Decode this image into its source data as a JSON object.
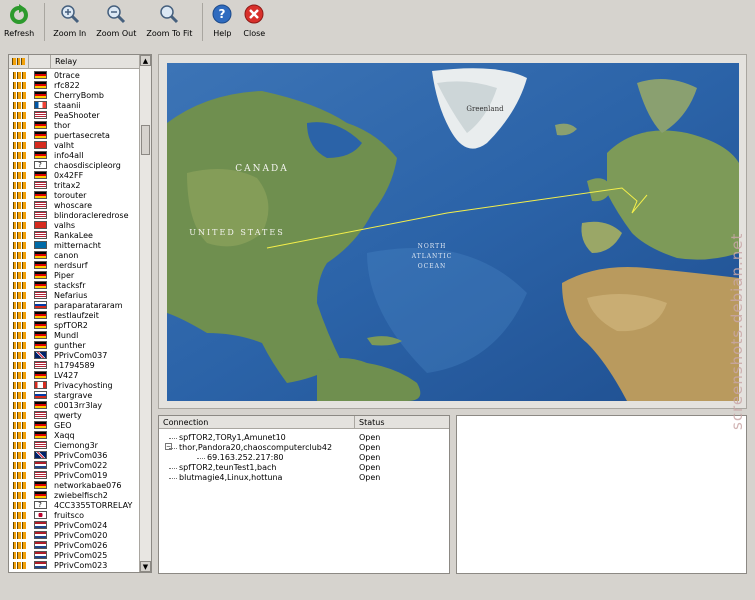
{
  "toolbar": {
    "refresh": "Refresh",
    "zoom_in": "Zoom In",
    "zoom_out": "Zoom Out",
    "zoom_fit": "Zoom To Fit",
    "help": "Help",
    "close": "Close"
  },
  "relay_list": {
    "header": "Relay",
    "items": [
      {
        "name": "0trace",
        "flag": "de"
      },
      {
        "name": "rfc822",
        "flag": "de"
      },
      {
        "name": "CherryBomb",
        "flag": "de"
      },
      {
        "name": "staanii",
        "flag": "fr"
      },
      {
        "name": "PeaShooter",
        "flag": "us"
      },
      {
        "name": "thor",
        "flag": "de"
      },
      {
        "name": "puertasecreta",
        "flag": "de"
      },
      {
        "name": "valht",
        "flag": "ch"
      },
      {
        "name": "info4all",
        "flag": "de"
      },
      {
        "name": "chaosdisciple​org",
        "flag": "unknown"
      },
      {
        "name": "0x42FF",
        "flag": "de"
      },
      {
        "name": "tritax2",
        "flag": "us"
      },
      {
        "name": "torouter",
        "flag": "de"
      },
      {
        "name": "whoscare",
        "flag": "us"
      },
      {
        "name": "blindoracleredrose",
        "flag": "us"
      },
      {
        "name": "valhs",
        "flag": "ch"
      },
      {
        "name": "RankaLee",
        "flag": "us"
      },
      {
        "name": "mitternacht",
        "flag": "se"
      },
      {
        "name": "canon",
        "flag": "de"
      },
      {
        "name": "nerdsurf",
        "flag": "de"
      },
      {
        "name": "Piper",
        "flag": "de"
      },
      {
        "name": "stacksfr",
        "flag": "de"
      },
      {
        "name": "Nefarius",
        "flag": "us"
      },
      {
        "name": "paraparatararam",
        "flag": "ru"
      },
      {
        "name": "restlaufzeit",
        "flag": "de"
      },
      {
        "name": "spfTOR2",
        "flag": "de"
      },
      {
        "name": "Mundl",
        "flag": "de"
      },
      {
        "name": "gunther",
        "flag": "de"
      },
      {
        "name": "PPrivCom037",
        "flag": "gb"
      },
      {
        "name": "h1794589",
        "flag": "us"
      },
      {
        "name": "LV427",
        "flag": "de"
      },
      {
        "name": "Privacyhosting",
        "flag": "ca"
      },
      {
        "name": "stargrave",
        "flag": "ru"
      },
      {
        "name": "c0013rr3lay",
        "flag": "de"
      },
      {
        "name": "qwerty",
        "flag": "us"
      },
      {
        "name": "GEO",
        "flag": "de"
      },
      {
        "name": "Xaqq",
        "flag": "de"
      },
      {
        "name": "Ciemong3r",
        "flag": "us"
      },
      {
        "name": "PPrivCom036",
        "flag": "gb"
      },
      {
        "name": "PPrivCom022",
        "flag": "nl"
      },
      {
        "name": "PPrivCom019",
        "flag": "us"
      },
      {
        "name": "networkabae076",
        "flag": "de"
      },
      {
        "name": "zwiebelfisch2",
        "flag": "de"
      },
      {
        "name": "4CC3355TORRELAY",
        "flag": "unknown"
      },
      {
        "name": "fruitsco",
        "flag": "jp"
      },
      {
        "name": "PPrivCom024",
        "flag": "nl"
      },
      {
        "name": "PPrivCom020",
        "flag": "nl"
      },
      {
        "name": "PPrivCom026",
        "flag": "nl"
      },
      {
        "name": "PPrivCom025",
        "flag": "nl"
      },
      {
        "name": "PPrivCom023",
        "flag": "nl"
      }
    ]
  },
  "map": {
    "labels": {
      "greenland": "Greenland",
      "canada": "CANADA",
      "united_states": "UNITED STATES",
      "ocean_1": "NORTH",
      "ocean_2": "ATLANTIC",
      "ocean_3": "OCEAN"
    }
  },
  "connections": {
    "header_connection": "Connection",
    "header_status": "Status",
    "rows": [
      {
        "name": "spfTOR2,TORy1,Amunet10",
        "status": "Open",
        "indent": 0
      },
      {
        "name": "thor,Pandora20,chaoscomputerclub42",
        "status": "Open",
        "indent": 0,
        "expanded": true
      },
      {
        "name": "69.163.252.217:80",
        "status": "Open",
        "indent": 1
      },
      {
        "name": "spfTOR2,teunTest1,bach",
        "status": "Open",
        "indent": 0
      },
      {
        "name": "blutmagie4,Linux,hottuna",
        "status": "Open",
        "indent": 0
      }
    ]
  },
  "watermark": "screenshots.debian.net",
  "colors": {
    "ocean": "#2b63a8",
    "land": "#6f8f4f",
    "accent": "#f2a10c"
  }
}
